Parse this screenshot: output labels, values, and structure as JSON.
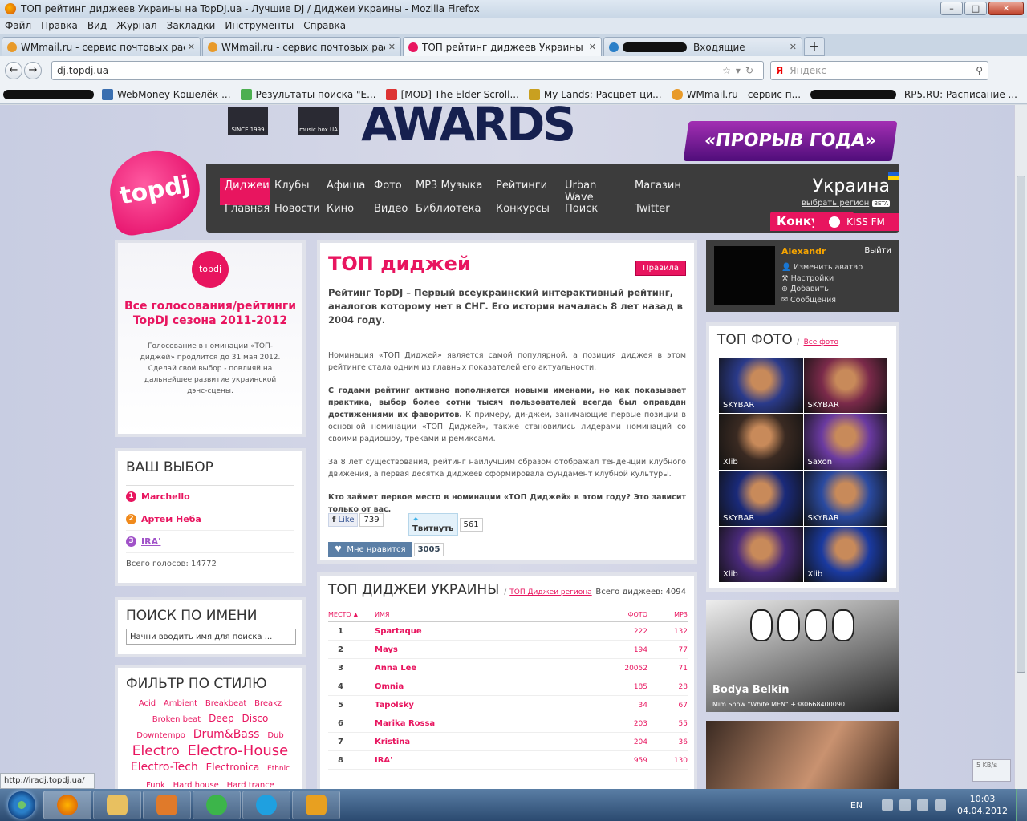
{
  "window": {
    "title": "ТОП рейтинг диджеев Украины на TopDJ.ua - Лучшие DJ / Диджеи Украины - Mozilla Firefox",
    "min": "–",
    "max": "□",
    "close": "✕"
  },
  "menu": [
    "Файл",
    "Правка",
    "Вид",
    "Журнал",
    "Закладки",
    "Инструменты",
    "Справка"
  ],
  "tabs": [
    {
      "label": "WMmail.ru - сервис почтовых расс...",
      "icon_color": "#e89a2a"
    },
    {
      "label": "WMmail.ru - сервис почтовых расс...",
      "icon_color": "#e89a2a"
    },
    {
      "label": "ТОП рейтинг диджеев Украины на ...",
      "icon_color": "#e8155f"
    },
    {
      "label": "Входящие",
      "icon_color": "#2a7fc8"
    }
  ],
  "url": "dj.topdj.ua",
  "search_placeholder": "Яндекс",
  "search_engine": "Я",
  "bookmarks": [
    "WebMoney Кошелёк ...",
    "Результаты поиска \"E...",
    "[MOD] The Elder Scroll...",
    "My Lands: Расцвет ци...",
    "WMmail.ru - сервис п...",
    "RP5.RU: Расписание ..."
  ],
  "banner": {
    "logo1": "SINCE 1999",
    "logo2": "music box UA",
    "text": "AWARDS",
    "promo": "«ПРОРЫВ ГОДА»"
  },
  "site": {
    "logo": "topdj",
    "nav_row1": [
      "Диджеи",
      "Клубы",
      "Афиша",
      "Фото",
      "MP3 Музыка",
      "Рейтинги",
      "Urban Wave",
      "Магазин"
    ],
    "nav_row2": [
      "Главная",
      "Новости",
      "Кино",
      "Видео",
      "Библиотека",
      "Конкурсы",
      "Поиск",
      "Twitter"
    ],
    "region": "Украина",
    "region_change": "выбрать регион",
    "beta": "BETA",
    "konkurs": "Конкурс $",
    "kissfm": "KISS FM"
  },
  "promo": {
    "logo": "topdj",
    "title": "Все голосования/рейтинги TopDJ сезона 2011-2012",
    "desc": "Голосование в номинации «ТОП-диджей» продлится до 31 мая 2012. Сделай свой выбор - повлияй на дальнейшее развитие украинской дэнс-сцены."
  },
  "vybor": {
    "title": "ВАШ ВЫБОР",
    "items": [
      {
        "n": "1",
        "name": "Marchello",
        "color": "#e8155f"
      },
      {
        "n": "2",
        "name": "Артем Неба",
        "color": "#f08a1c"
      },
      {
        "n": "3",
        "name": "IRA'",
        "color": "#a052c8"
      }
    ],
    "total": "Всего голосов: 14772"
  },
  "poisk": {
    "title": "ПОИСК ПО ИМЕНИ",
    "placeholder": "Начни вводить имя для поиска ..."
  },
  "filtr": {
    "title": "ФИЛЬТР ПО СТИЛЮ",
    "tags": [
      {
        "t": "Acid",
        "s": 10
      },
      {
        "t": "Ambient",
        "s": 10
      },
      {
        "t": "Breakbeat",
        "s": 10
      },
      {
        "t": "Breakz",
        "s": 10
      },
      {
        "t": "Broken beat",
        "s": 10
      },
      {
        "t": "Deep",
        "s": 12
      },
      {
        "t": "Disco",
        "s": 12
      },
      {
        "t": "Downtempo",
        "s": 10
      },
      {
        "t": "Drum&Bass",
        "s": 14
      },
      {
        "t": "Dub",
        "s": 10
      },
      {
        "t": "Electro",
        "s": 17
      },
      {
        "t": "Electro-House",
        "s": 18
      },
      {
        "t": "Electro-Tech",
        "s": 14
      },
      {
        "t": "Electronica",
        "s": 12
      },
      {
        "t": "Ethnic",
        "s": 9
      },
      {
        "t": "Funk",
        "s": 10
      },
      {
        "t": "Hard house",
        "s": 10
      },
      {
        "t": "Hard trance",
        "s": 10
      }
    ]
  },
  "content": {
    "title": "ТОП диджей",
    "rules": "Правила",
    "lead": "Рейтинг TopDJ – Первый всеукраинский интерактивный рейтинг, аналогов которому нет в СНГ. Его история началась 8 лет назад в 2004 году.",
    "p1": "Номинация «ТОП Диджей» является самой популярной, а позиция диджея в этом рейтинге стала одним из главных показателей его актуальности.",
    "p2_bold": "С годами рейтинг активно пополняется новыми именами, но как показывает практика, выбор более сотни тысяч пользователей всегда был оправдан достижениями их фаворитов.",
    "p2_rest": " К примеру, ди-джеи, занимающие первые позиции в основной номинации «ТОП Диджей», также становились лидерами номинаций со своими радиошоу, треками и ремиксами.",
    "p3": "За 8 лет существования, рейтинг наилучшим образом отображал тенденции клубного движения, а первая десятка диджеев сформировала фундамент клубной культуры.",
    "p4": "Кто займет первое место в номинации «ТОП Диджей» в этом году? Это зависит только от вас.",
    "fb_like": "Like",
    "fb_count": "739",
    "tw": "Твитнуть",
    "tw_count": "561",
    "like": "Мне нравится",
    "like_count": "3005"
  },
  "rating": {
    "title": "ТОП ДИДЖЕИ УКРАИНЫ",
    "region_link": "ТОП Диджеи региона",
    "total": "Всего диджеев: 4094",
    "cols": {
      "place": "МЕСТО",
      "name": "ИМЯ",
      "photo": "ФОТО",
      "mp3": "MP3"
    },
    "rows": [
      {
        "n": "1",
        "name": "Spartaque",
        "photo": "222",
        "mp3": "132"
      },
      {
        "n": "2",
        "name": "Mays",
        "photo": "194",
        "mp3": "77"
      },
      {
        "n": "3",
        "name": "Anna Lee",
        "photo": "20052",
        "mp3": "71"
      },
      {
        "n": "4",
        "name": "Omnia",
        "photo": "185",
        "mp3": "28"
      },
      {
        "n": "5",
        "name": "Tapolsky",
        "photo": "34",
        "mp3": "67"
      },
      {
        "n": "6",
        "name": "Marika Rossa",
        "photo": "203",
        "mp3": "55"
      },
      {
        "n": "7",
        "name": "Kristina",
        "photo": "204",
        "mp3": "36"
      },
      {
        "n": "8",
        "name": "IRA'",
        "photo": "959",
        "mp3": "130"
      }
    ]
  },
  "user": {
    "name": "Alexandr",
    "logout": "Выйти",
    "links": [
      "Изменить аватар",
      "Настройки",
      "Добавить",
      "Сообщения"
    ]
  },
  "topfoto": {
    "title": "ТОП ФОТО",
    "all": "Все фото",
    "photos": [
      {
        "label": "SKYBAR",
        "color": "#2a3a8a"
      },
      {
        "label": "SKYBAR",
        "color": "#7a2a4a"
      },
      {
        "label": "Xlib",
        "color": "#3a2a22"
      },
      {
        "label": "Saxon",
        "color": "#6a3aa0"
      },
      {
        "label": "SKYBAR",
        "color": "#1a2a7a"
      },
      {
        "label": "SKYBAR",
        "color": "#2a4aa0"
      },
      {
        "label": "Xlib",
        "color": "#4a2a7a"
      },
      {
        "label": "Xlib",
        "color": "#1a3aa0"
      }
    ]
  },
  "promo2": {
    "name": "Bodya Belkin",
    "sub": "Mim Show \"White MEN\" +380668400090"
  },
  "status": "http://iradj.topdj.ua/",
  "speed": "5 KB/s",
  "tray": {
    "lang": "EN",
    "time": "10:03",
    "date": "04.04.2012"
  }
}
